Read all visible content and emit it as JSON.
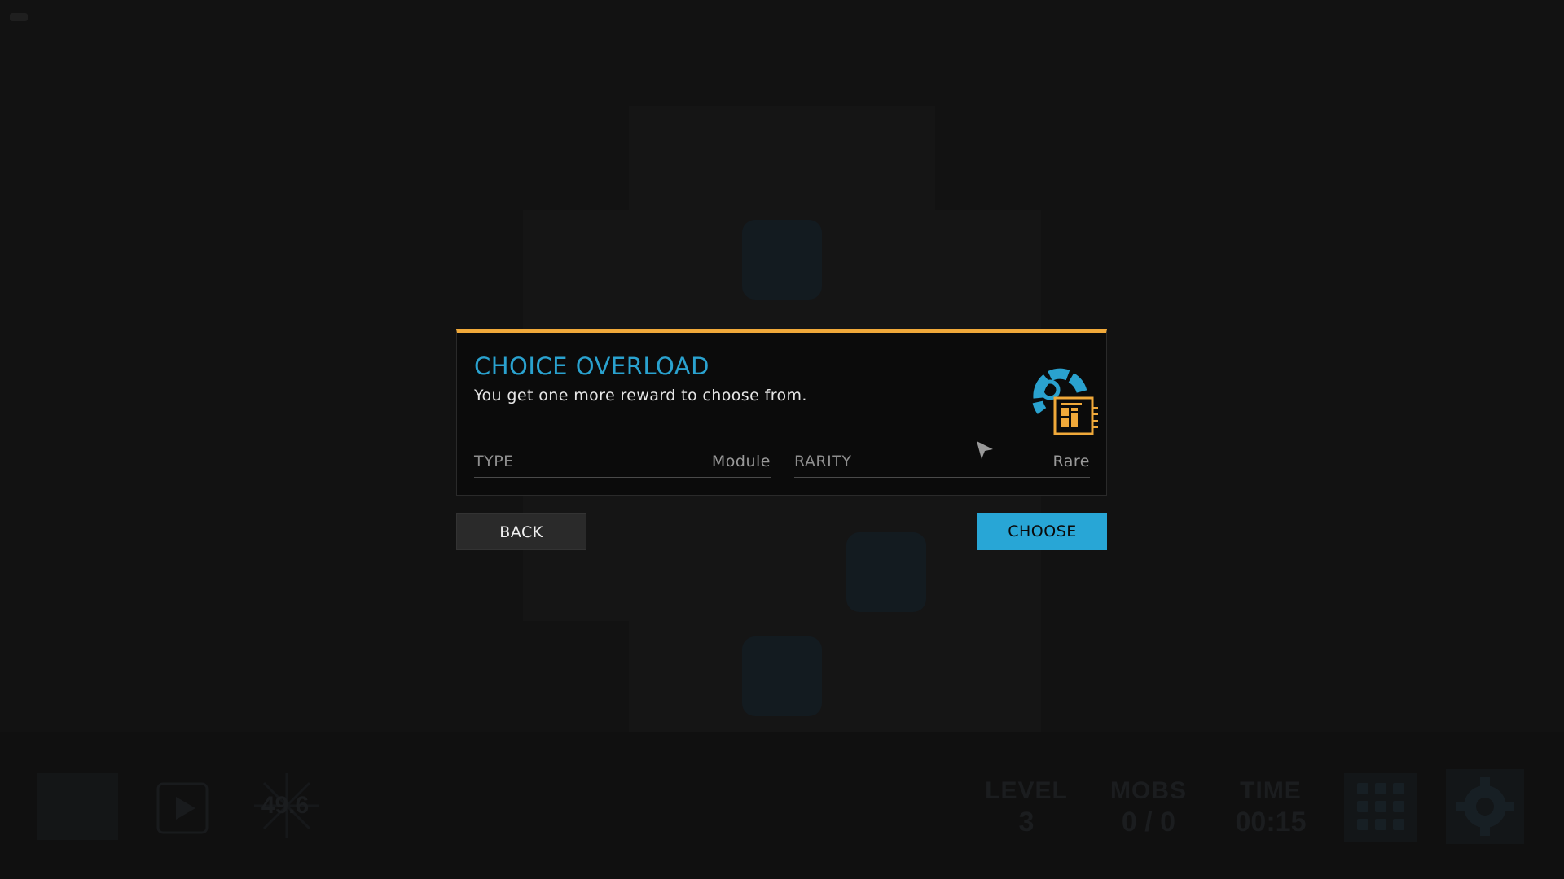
{
  "dialog": {
    "title": "CHOICE OVERLOAD",
    "description": "You get one more reward to choose from.",
    "icon": "module-reward-icon",
    "stats": {
      "type_label": "TYPE",
      "type_value": "Module",
      "rarity_label": "RARITY",
      "rarity_value": "Rare"
    }
  },
  "buttons": {
    "back_label": "BACK",
    "choose_label": "CHOOSE"
  },
  "hud": {
    "speed": "49.6",
    "level_label": "LEVEL",
    "level_value": "3",
    "mobs_label": "MOBS",
    "mobs_value": "0 / 0",
    "time_label": "TIME",
    "time_value": "00:15"
  },
  "colors": {
    "accent_blue": "#2aa2cf",
    "accent_orange": "#f0a93a",
    "choose_button": "#28a6d6"
  }
}
